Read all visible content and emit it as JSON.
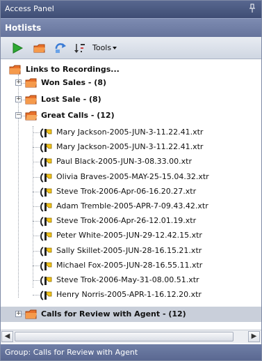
{
  "window": {
    "title": "Access Panel"
  },
  "panel": {
    "title": "Hotlists"
  },
  "toolbar": {
    "tools_label": "Tools"
  },
  "tree": {
    "root": "Links to Recordings...",
    "folders": {
      "won": "Won Sales - (8)",
      "lost": "Lost Sale - (8)",
      "great": "Great Calls - (12)",
      "review": "Calls for Review with Agent - (12)"
    },
    "recordings": [
      "Mary Jackson-2005-JUN-3-11.22.41.xtr",
      "Mary Jackson-2005-JUN-3-11.22.41.xtr",
      "Paul Black-2005-JUN-3-08.33.00.xtr",
      "Olivia Braves-2005-MAY-25-15.04.32.xtr",
      "Steve Trok-2006-Apr-06-16.20.27.xtr",
      "Adam Tremble-2005-APR-7-09.43.42.xtr",
      "Steve Trok-2006-Apr-26-12.01.19.xtr",
      "Peter White-2005-JUN-29-12.42.15.xtr",
      "Sally Skillet-2005-JUN-28-16.15.21.xtr",
      "Michael Fox-2005-JUN-28-16.55.11.xtr",
      "Steve Trok-2006-May-31-08.00.51.xtr",
      "Henry Norris-2005-APR-1-16.12.20.xtr"
    ]
  },
  "status": {
    "text": "Group: Calls for Review with Agent"
  },
  "colors": {
    "titlebar": "#4a5880",
    "selection": "#c9cfda",
    "folder": "#e8702a",
    "recording": "#f2c41a"
  }
}
